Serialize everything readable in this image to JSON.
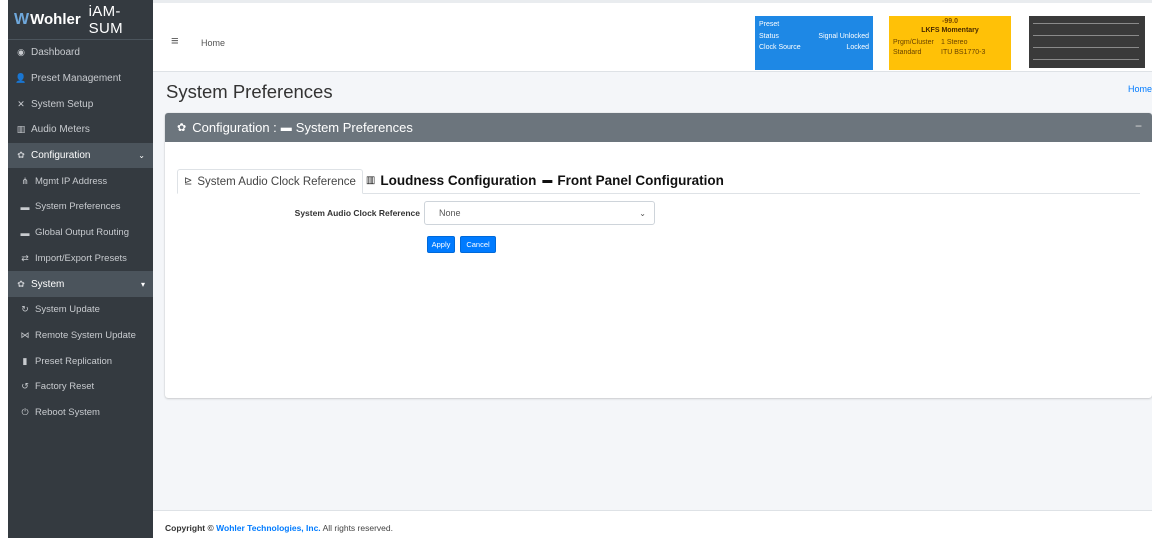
{
  "brand": {
    "logo": "Wohler",
    "product": "iAM-SUM"
  },
  "sidebar": {
    "items": [
      {
        "label": "Dashboard",
        "icon": "dashboard-icon",
        "glyph": "◉"
      },
      {
        "label": "Preset Management",
        "icon": "users-icon",
        "glyph": "👤"
      },
      {
        "label": "System Setup",
        "icon": "tools-icon",
        "glyph": "✕"
      },
      {
        "label": "Audio Meters",
        "icon": "chart-bar-icon",
        "glyph": "▥"
      }
    ],
    "config_group": {
      "label": "Configuration",
      "glyph": "✿",
      "chev": "⌄"
    },
    "config_items": [
      {
        "label": "Mgmt IP Address",
        "glyph": "⋔"
      },
      {
        "label": "System Preferences",
        "glyph": "▬"
      },
      {
        "label": "Global Output Routing",
        "glyph": "▬"
      },
      {
        "label": "Import/Export Presets",
        "glyph": "⇄"
      }
    ],
    "system_group": {
      "label": "System",
      "glyph": "✿",
      "chev": "▾"
    },
    "system_items": [
      {
        "label": "System Update",
        "glyph": "↻"
      },
      {
        "label": "Remote System Update",
        "glyph": "⋈"
      },
      {
        "label": "Preset Replication",
        "glyph": "▮"
      },
      {
        "label": "Factory Reset",
        "glyph": "↺"
      },
      {
        "label": "Reboot System",
        "glyph": "⏻"
      }
    ]
  },
  "topbar": {
    "menu_glyph": "≡",
    "home": "Home",
    "preset": {
      "label": "Preset",
      "status_label": "Status",
      "status_value": "Signal Unlocked",
      "clock_label": "Clock Source",
      "clock_value": "Locked"
    },
    "lkfs": {
      "value": "-99.0",
      "header": "LKFS  Momentary",
      "cluster_label": "Prgm/Cluster",
      "cluster_value": "1  Stereo",
      "standard_label": "Standard",
      "standard_value": "ITU BS1770-3"
    }
  },
  "main": {
    "title": "System Preferences",
    "breadcrumb_home": "Home",
    "card": {
      "header_prefix": "Configuration :",
      "header_page": "System Preferences",
      "collapse": "−",
      "tabs": [
        {
          "label": "System Audio Clock Reference",
          "glyph": "⊵"
        },
        {
          "label": "Loudness Configuration",
          "glyph": "▥"
        },
        {
          "label": "Front Panel Configuration",
          "glyph": "▬"
        }
      ],
      "field_label": "System Audio Clock Reference",
      "field_value": "None",
      "apply": "Apply",
      "cancel": "Cancel"
    }
  },
  "footer": {
    "prefix": "Copyright ©",
    "company": "Wohler Technologies, Inc.",
    "suffix": "All rights reserved."
  }
}
